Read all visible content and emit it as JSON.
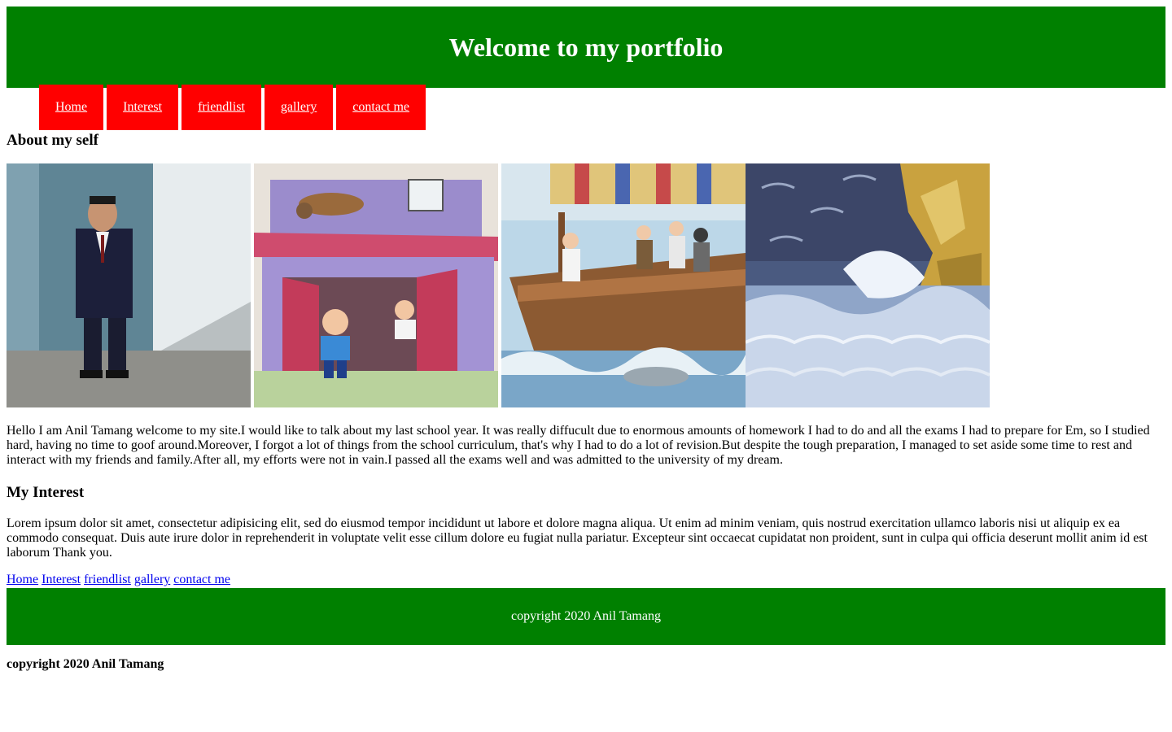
{
  "header": {
    "title": "Welcome to my portfolio"
  },
  "nav": {
    "items": [
      "Home",
      "Interest",
      "friendlist",
      "gallery",
      "contact me"
    ]
  },
  "about": {
    "heading": "About my self"
  },
  "gallery": {
    "images": [
      "boy-in-school-uniform-photo",
      "cartoon-boys-running-from-house-photo",
      "ship-in-storm-illustration-photo",
      "stormy-sea-cliff-illustration-photo"
    ]
  },
  "bio": {
    "text": "Hello I am Anil Tamang welcome to my site.I would like to talk about my last school year. It was really diffucult due to enormous amounts of homework I had to do and all the exams I had to prepare for Em, so I studied hard, having no time to goof around.Moreover, I forgot a lot of things from the school curriculum, that's why I had to do a lot of revision.But despite the tough preparation, I managed to set aside some time to rest and interact with my friends and family.After all, my efforts were not in vain.I passed all the exams well and was admitted to the university of my dream."
  },
  "interest": {
    "heading": "My Interest",
    "text": "Lorem ipsum dolor sit amet, consectetur adipisicing elit, sed do eiusmod tempor incididunt ut labore et dolore magna aliqua. Ut enim ad minim veniam, quis nostrud exercitation ullamco laboris nisi ut aliquip ex ea commodo consequat. Duis aute irure dolor in reprehenderit in voluptate velit esse cillum dolore eu fugiat nulla pariatur. Excepteur sint occaecat cupidatat non proident, sunt in culpa qui officia deserunt mollit anim id est laborum Thank you."
  },
  "footer_links": [
    "Home",
    "Interest",
    "friendlist",
    "gallery",
    "contact me"
  ],
  "footer": {
    "copyright": "copyright 2020 Anil Tamang"
  },
  "bottom": {
    "copyright": "copyright 2020 Anil Tamang"
  },
  "colors": {
    "header_bg": "#008000",
    "nav_bg": "#ff0000",
    "link": "#0000ee"
  }
}
